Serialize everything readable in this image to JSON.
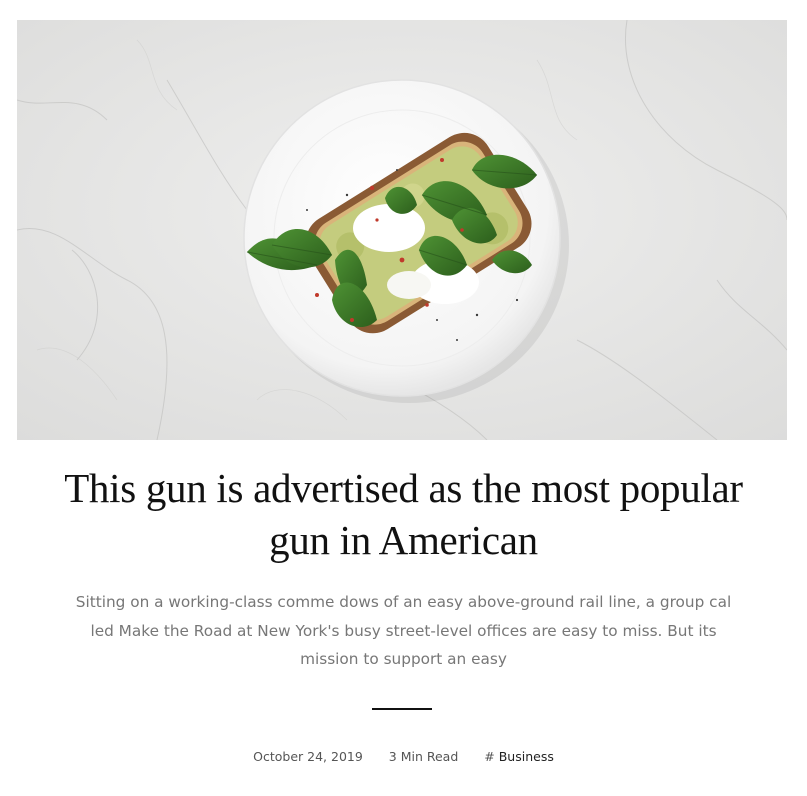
{
  "post": {
    "image": {
      "alt": "Avocado toast with spinach and poached egg on a white plate",
      "colors": {
        "marble": "#e9e9e8",
        "plate": "#fafafa",
        "bread_crust": "#8a5a34",
        "avocado": "#c4cc7e",
        "spinach": "#3d7a28",
        "egg": "#ffffff"
      }
    },
    "title": "This gun is advertised as the most popular gun in American",
    "excerpt": "Sitting on a working-class comme dows of an easy above-ground rail line, a group cal led Make the Road at New York's busy street-level offices are easy to miss. But its mission to support an easy",
    "meta": {
      "date": "October 24, 2019",
      "read_time": "3 Min Read",
      "tag_symbol": "#",
      "tag": "Business"
    }
  }
}
